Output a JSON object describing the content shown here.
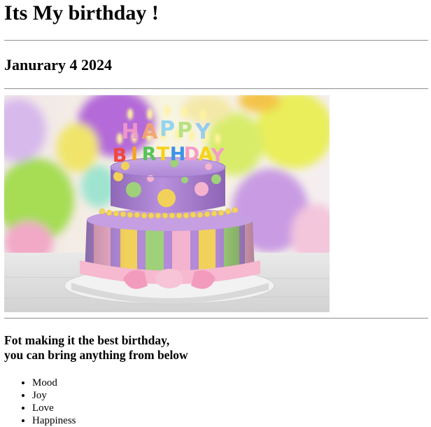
{
  "page": {
    "title": "Its My birthday !",
    "date": "Janurary 4 2024",
    "message_line1": "Fot making it the best birthday,",
    "message_line2": "you can bring anything from below",
    "items": [
      "Mood",
      "Joy",
      "Love",
      "Happiness"
    ]
  },
  "cake_image": {
    "topper_line1": "HAPPY",
    "topper_line2": "BIRTHDAY",
    "colors": {
      "top_tier": "#b48ad6",
      "stripe_yellow": "#f2d15a",
      "stripe_green": "#9fd07a",
      "stripe_pink": "#f4b3cf",
      "ribbon_pink": "#f6b9cf",
      "balloon_purple": "#b46ad8",
      "balloon_yellow": "#e9ee5a",
      "balloon_green": "#a6dd55"
    }
  }
}
